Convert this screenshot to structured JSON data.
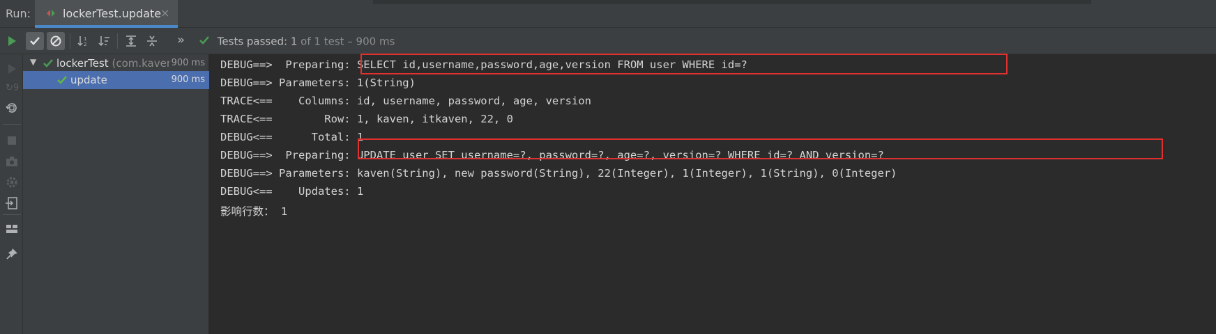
{
  "run_panel": {
    "run_label": "Run:",
    "tab": {
      "title": "lockerTest.update",
      "close": "×"
    }
  },
  "toolbar": {
    "buttons": [
      "rerun-icon",
      "show-passed-icon",
      "show-ignored-icon",
      "sort-alphabetically-icon",
      "sort-by-duration-icon",
      "expand-all-icon",
      "collapse-all-icon",
      "more-icon"
    ],
    "more_label": "»",
    "status_prefix": "Tests passed:",
    "status_count": "1",
    "status_detail": "of 1 test – 900 ms"
  },
  "test_tree": {
    "root": {
      "name": "lockerTest",
      "package": "(com.kaven",
      "time": "900 ms"
    },
    "child": {
      "name": "update",
      "time": "900 ms"
    }
  },
  "console": {
    "lines": [
      {
        "prefix": "DEBUG==>  Preparing: ",
        "text": "SELECT id,username,password,age,version FROM user WHERE id=?"
      },
      {
        "prefix": "DEBUG==> Parameters: ",
        "text": "1(String)"
      },
      {
        "prefix": "TRACE<==    Columns: ",
        "text": "id, username, password, age, version"
      },
      {
        "prefix": "TRACE<==        Row: ",
        "text": "1, kaven, itkaven, 22, 0"
      },
      {
        "prefix": "DEBUG<==      Total: ",
        "text": "1"
      },
      {
        "prefix": "DEBUG==>  Preparing: ",
        "text": "UPDATE user SET username=?, password=?, age=?, version=? WHERE id=? AND version=?"
      },
      {
        "prefix": "DEBUG==> Parameters: ",
        "text": "kaven(String), new password(String), 22(Integer), 1(Integer), 1(String), 0(Integer)"
      },
      {
        "prefix": "DEBUG<==    Updates: ",
        "text": "1"
      },
      {
        "prefix": "影响行数： ",
        "text": "1"
      }
    ]
  },
  "colors": {
    "success": "#499c54",
    "highlight": "#e0302f",
    "selection": "#4b6eaf"
  }
}
